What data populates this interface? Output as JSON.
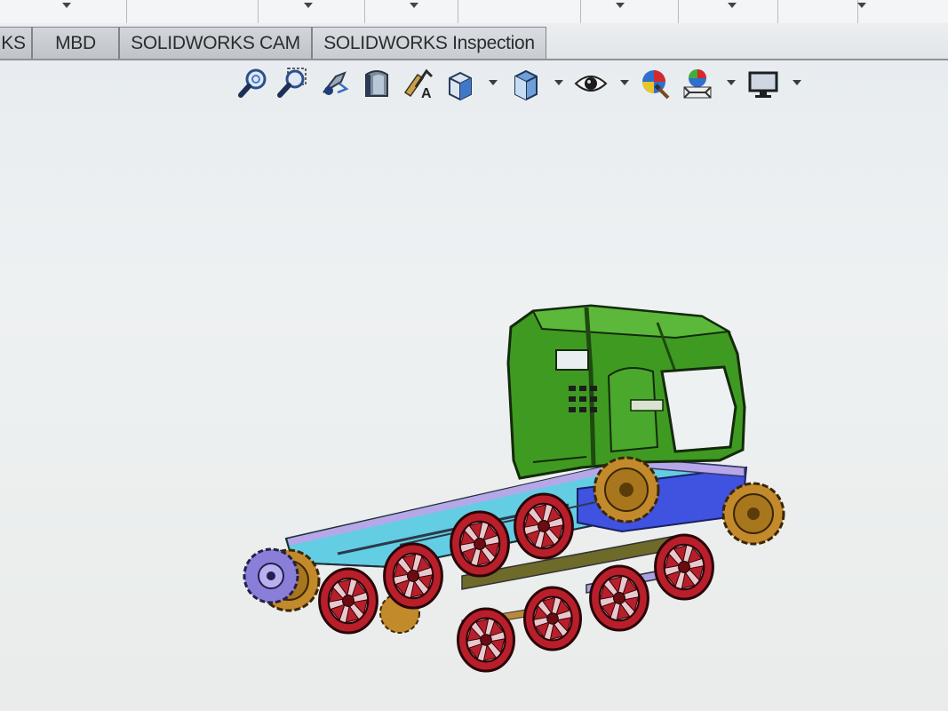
{
  "tabs": [
    {
      "label": "KS"
    },
    {
      "label": "MBD"
    },
    {
      "label": "SOLIDWORKS CAM"
    },
    {
      "label": "SOLIDWORKS Inspection"
    }
  ],
  "toolbar": {
    "icons": [
      "zoom-to-fit-icon",
      "zoom-to-area-icon",
      "previous-view-icon",
      "section-view-icon",
      "dynamic-annotation-views-icon",
      "view-orientation-icon",
      "display-style-icon",
      "hide-show-items-icon",
      "edit-appearance-icon",
      "apply-scene-icon",
      "view-settings-icon"
    ]
  },
  "colors": {
    "cab": "#3f9a22",
    "chassis_blue": "#3f52e0",
    "chassis_cyan": "#5fd0e4",
    "wheel_red": "#b81f2a",
    "sprocket_gold": "#c28a2a",
    "idler_purple": "#8a7fd8"
  }
}
